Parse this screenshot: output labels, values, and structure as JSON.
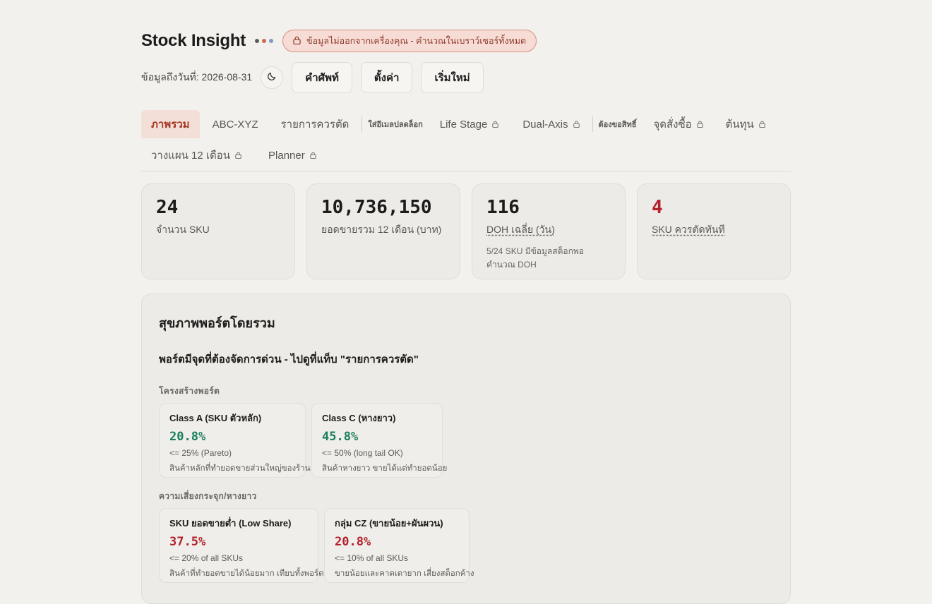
{
  "header": {
    "app_title": "Stock Insight",
    "dot_colors": [
      "#5f5b56",
      "#d06a4f",
      "#7f9cc0"
    ],
    "privacy_notice": "ข้อมูลไม่ออกจากเครื่องคุณ - คำนวณในเบราว์เซอร์ทั้งหมด",
    "data_date": "ข้อมูลถึงวันที่: 2026-08-31",
    "buttons": {
      "glossary": "คำศัพท์",
      "settings": "ตั้งค่า",
      "reset": "เริ่มใหม่"
    }
  },
  "tabs": {
    "overview": "ภาพรวม",
    "abc_xyz": "ABC-XYZ",
    "to_cut": "รายการควรตัด",
    "email_unlock_label": "ใส่อีเมลปลดล็อก",
    "life_stage": "Life Stage",
    "dual_axis": "Dual-Axis",
    "permission_label": "ต้องขอสิทธิ์",
    "reorder_point": "จุดสั่งซื้อ",
    "cost": "ต้นทุน",
    "plan_12m": "วางแผน 12 เดือน",
    "planner": "Planner"
  },
  "stats": {
    "sku_count": {
      "value": "24",
      "label": "จำนวน SKU"
    },
    "sales_12m": {
      "value": "10,736,150",
      "label": "ยอดขายรวม 12 เดือน (บาท)"
    },
    "avg_doh": {
      "value": "116",
      "label": "DOH เฉลี่ย (วัน)",
      "note": "5/24 SKU มีข้อมูลสต็อกพอคำนวณ DOH"
    },
    "cut_now": {
      "value": "4",
      "label": "SKU ควรตัดทันที"
    }
  },
  "health": {
    "title": "สุขภาพพอร์ตโดยรวม",
    "alert": "พอร์ตมีจุดที่ต้องจัดการด่วน - ไปดูที่แท็บ \"รายการควรตัด\"",
    "structure_label": "โครงสร้างพอร์ต",
    "class_a": {
      "title": "Class A (SKU ตัวหลัก)",
      "value": "20.8%",
      "target": "<= 25% (Pareto)",
      "desc": "สินค้าหลักที่ทำยอดขายส่วนใหญ่ของร้าน"
    },
    "class_c": {
      "title": "Class C (หางยาว)",
      "value": "45.8%",
      "target": "<= 50% (long tail OK)",
      "desc": "สินค้าหางยาว ขายได้แต่ทำยอดน้อย"
    },
    "risk_label": "ความเสี่ยงกระจุก/หางยาว",
    "low_share": {
      "title": "SKU ยอดขายต่ำ (Low Share)",
      "value": "37.5%",
      "target": "<= 20% of all SKUs",
      "desc": "สินค้าที่ทำยอดขายได้น้อยมาก เทียบทั้งพอร์ต"
    },
    "cz_group": {
      "title": "กลุ่ม CZ (ขายน้อย+ผันผวน)",
      "value": "20.8%",
      "target": "<= 10% of all SKUs",
      "desc": "ขายน้อยและคาดเดายาก เสี่ยงสต็อกค้าง"
    }
  }
}
